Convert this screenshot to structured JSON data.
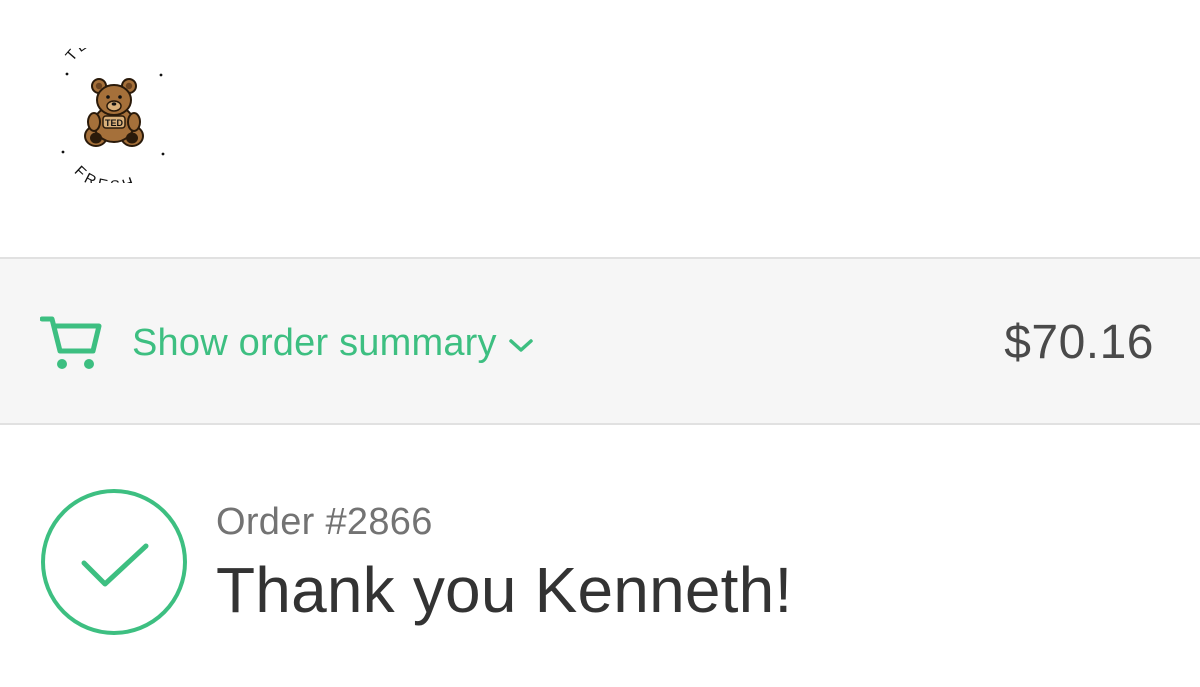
{
  "brand": {
    "logo_top_text": "TEDDY",
    "logo_bottom_text": "FRESH",
    "logo_badge_text": "TED"
  },
  "summary": {
    "toggle_label": "Show order summary",
    "total": "$70.16",
    "icon": "cart-icon",
    "toggle_icon": "chevron-down-icon"
  },
  "confirmation": {
    "order_number": "Order #2866",
    "message": "Thank you Kenneth!",
    "icon": "checkmark-circle-icon"
  },
  "colors": {
    "accent": "#3dbf81",
    "summary_bg": "#f6f6f6",
    "text_dark": "#333333",
    "text_muted": "#737373"
  }
}
